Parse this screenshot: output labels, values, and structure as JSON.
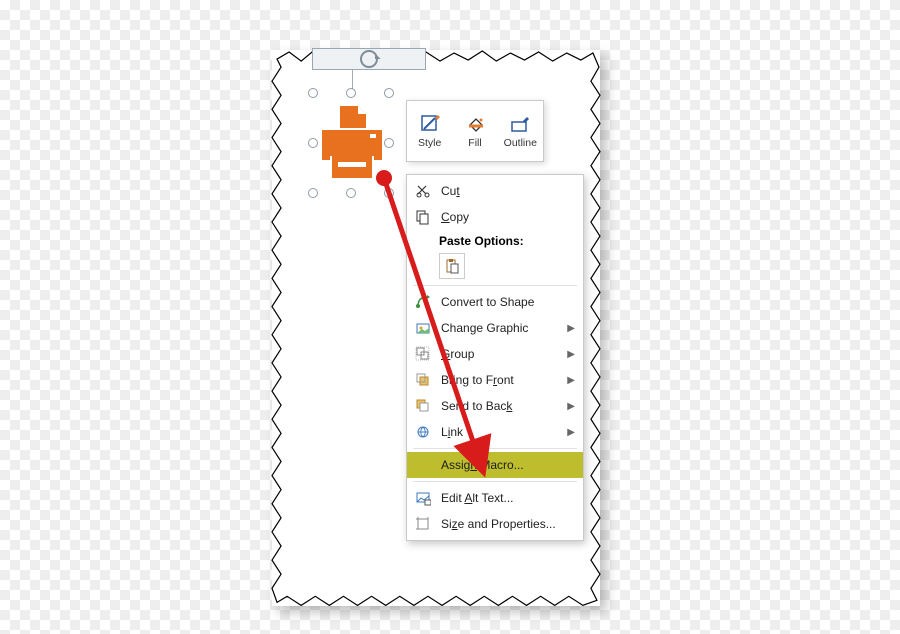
{
  "colors": {
    "printer": "#e8711f",
    "highlight_bg": "#bdbd2e",
    "arrow": "#d81b1b"
  },
  "rotation_handle": {
    "tooltip": "Rotate"
  },
  "selected_object": {
    "name": "Printer icon"
  },
  "mini_toolbar": {
    "style": "Style",
    "fill": "Fill",
    "outline": "Outline"
  },
  "context_menu": {
    "cut": "Cut",
    "copy": "Copy",
    "paste_options": "Paste Options:",
    "convert_to_shape": "Convert to Shape",
    "change_graphic": "Change Graphic",
    "group": "Group",
    "bring_to_front": "Bring to Front",
    "send_to_back": "Send to Back",
    "link": "Link",
    "assign_macro": "Assign Macro...",
    "edit_alt_text": "Edit Alt Text...",
    "size_and_properties": "Size and Properties..."
  }
}
